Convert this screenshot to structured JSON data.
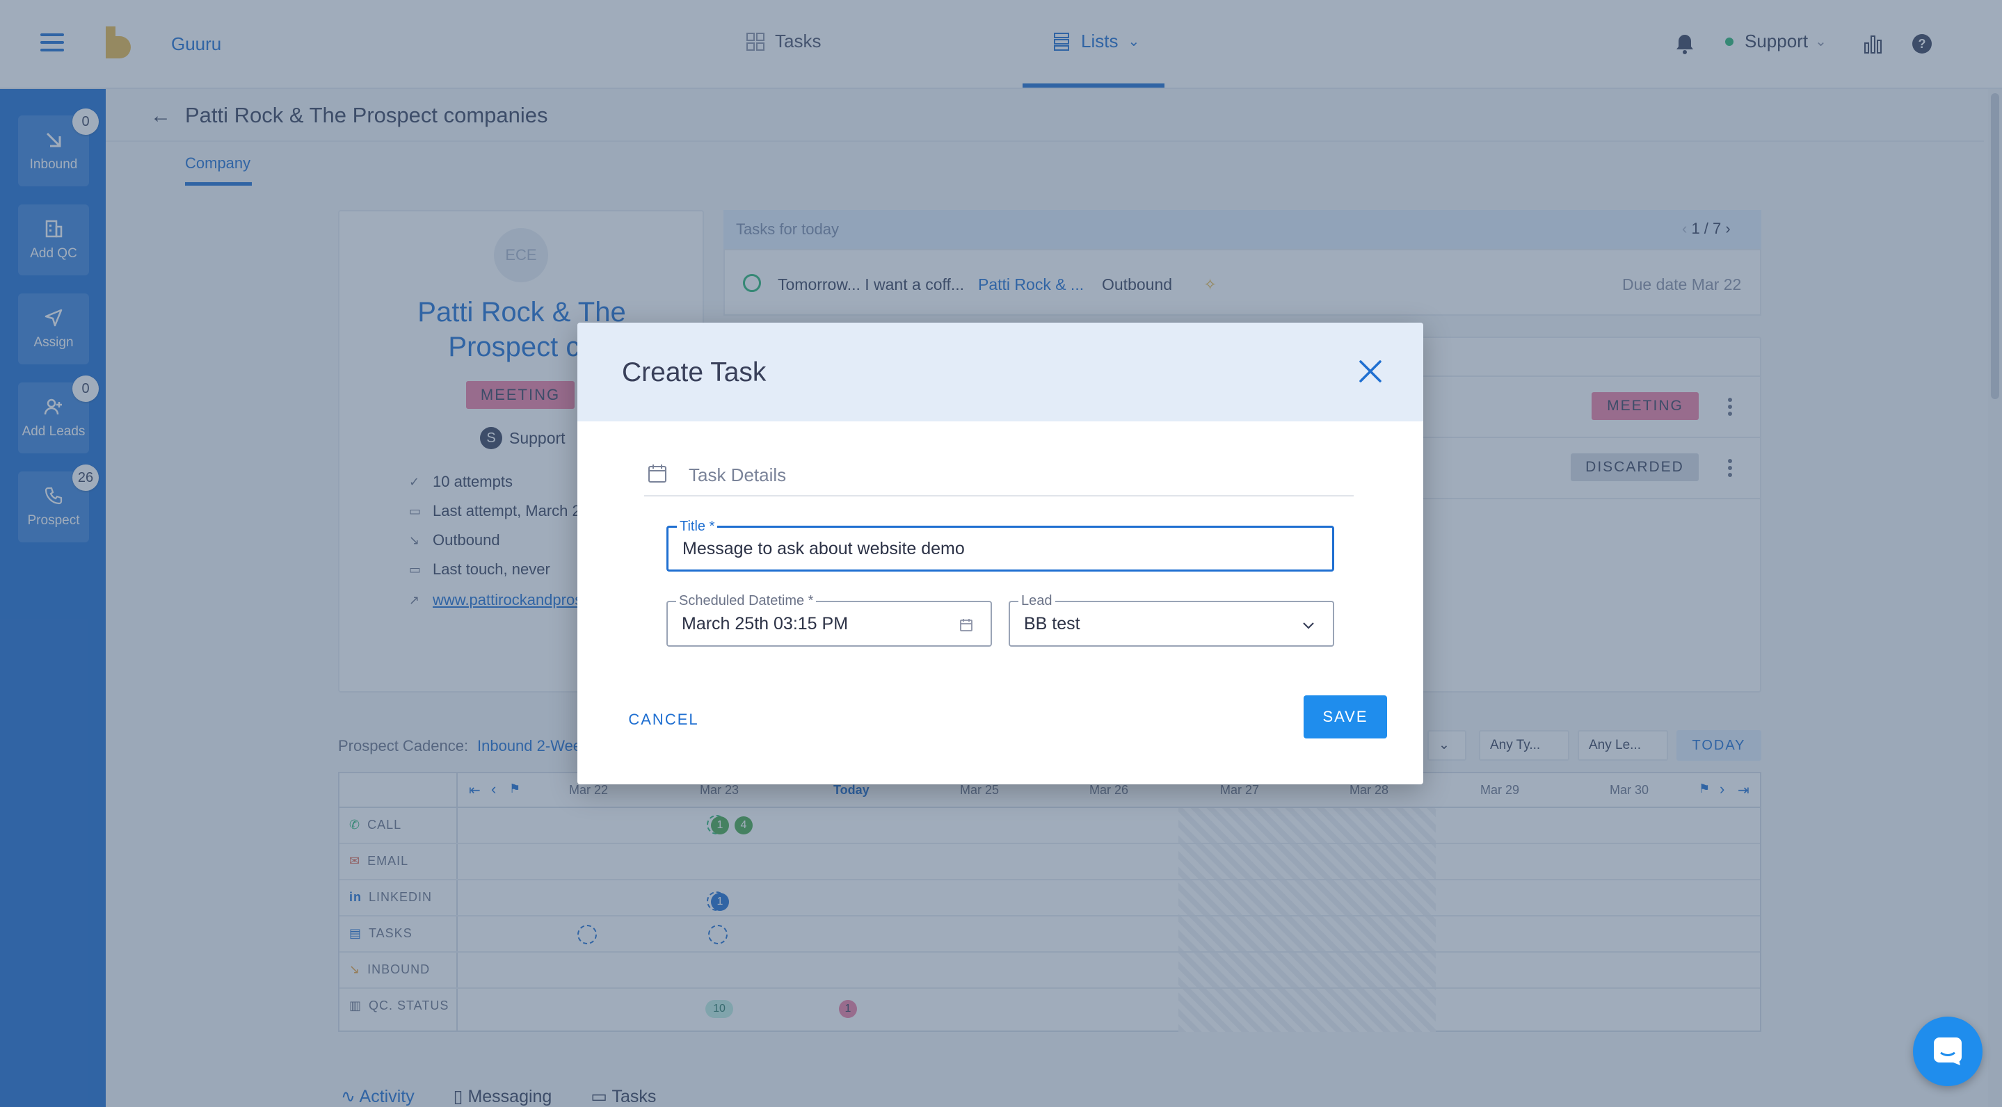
{
  "app": {
    "brand": "Guuru",
    "nav_tabs": [
      {
        "label": "Tasks"
      },
      {
        "label": "Lists"
      }
    ],
    "user": "Support"
  },
  "sidebar": {
    "items": [
      {
        "label": "Inbound",
        "badge": "0"
      },
      {
        "label": "Add QC",
        "badge": ""
      },
      {
        "label": "Assign",
        "badge": ""
      },
      {
        "label": "Add Leads",
        "badge": "0"
      },
      {
        "label": "Prospect",
        "badge": "26"
      }
    ]
  },
  "page": {
    "title": "Patti Rock & The Prospect companies",
    "tab": "Company"
  },
  "company": {
    "avatar_initials": "ECE",
    "name": "Patti Rock & The Prospect co",
    "status_badge": "MEETING",
    "owner_initial": "S",
    "owner": "Support",
    "info": [
      "10 attempts",
      "Last attempt, March 2",
      "Outbound",
      "Last touch, never"
    ],
    "website": "www.pattirockandpros"
  },
  "tasks_today": {
    "header": "Tasks for today",
    "pager": "1 / 7",
    "task_text": "Tomorrow... I want a coff...",
    "task_company": "Patti Rock & ...",
    "task_type": "Outbound",
    "due": "Due date Mar 22"
  },
  "lead_rows": [
    {
      "badge": "MEETING"
    },
    {
      "badge": "DISCARDED"
    }
  ],
  "cadence": {
    "label": "Prospect Cadence:",
    "link": "Inbound 2-Wee",
    "filters": [
      "Any Ty...",
      "Any Le..."
    ],
    "today_btn": "TODAY",
    "columns": [
      "Mar 22",
      "Mar 23",
      "Today",
      "Mar 25",
      "Mar 26",
      "Mar 27",
      "Mar 28",
      "Mar 29",
      "Mar 30"
    ],
    "rows": [
      "CALL",
      "EMAIL",
      "LINKEDIN",
      "TASKS",
      "INBOUND",
      "QC. STATUS"
    ],
    "call_counts": [
      "1",
      "4"
    ],
    "linkedin_count": "1",
    "qc_counts": [
      "10",
      "1"
    ]
  },
  "bottom_tabs": [
    "Activity",
    "Messaging",
    "Tasks"
  ],
  "modal": {
    "title": "Create Task",
    "section": "Task Details",
    "title_field": {
      "label": "Title *",
      "value": "Message to ask about website demo"
    },
    "datetime_field": {
      "label": "Scheduled Datetime *",
      "value": "March 25th 03:15 PM"
    },
    "lead_field": {
      "label": "Lead",
      "value": "BB test"
    },
    "cancel_label": "CANCEL",
    "save_label": "SAVE"
  },
  "colors": {
    "primary": "#1f6fd1",
    "save": "#1f8ded",
    "meeting": "#ef7fa3",
    "overlay": "rgba(66,90,120,0.5)"
  }
}
